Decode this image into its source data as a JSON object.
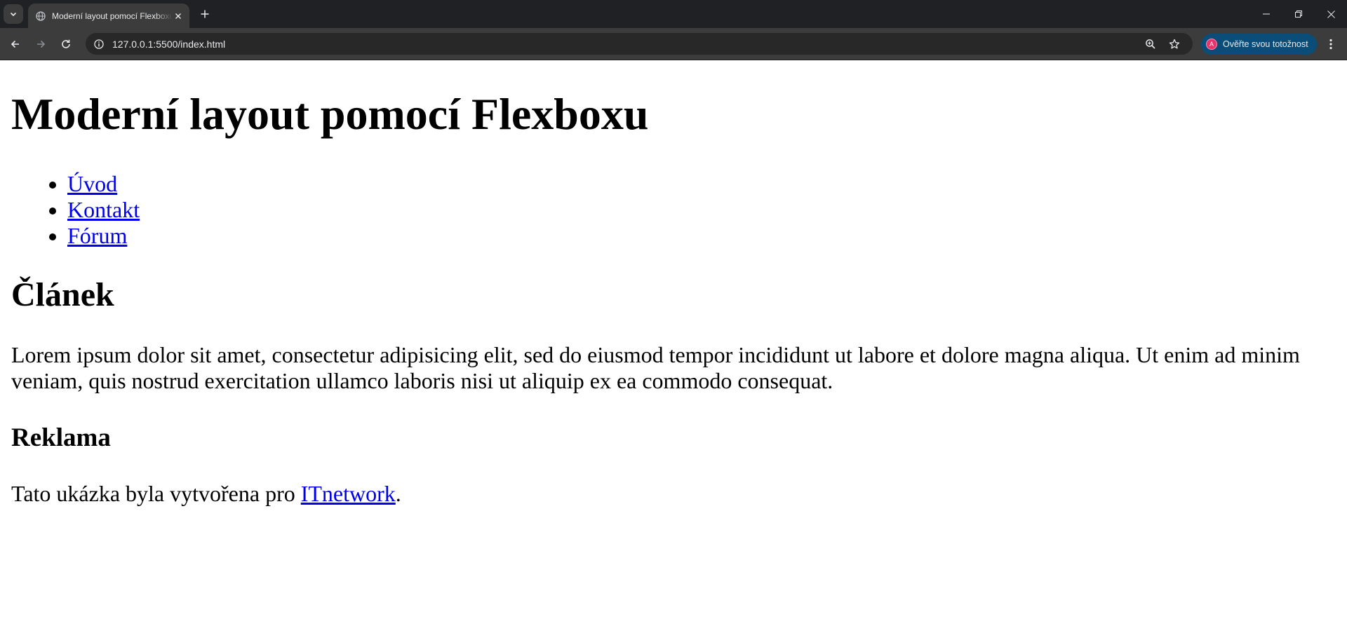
{
  "browser": {
    "tab_title": "Moderní layout pomocí Flexboxu",
    "url": "127.0.0.1:5500/index.html",
    "profile_label": "Ověřte svou totožnost",
    "profile_initial": "A"
  },
  "page": {
    "heading": "Moderní layout pomocí Flexboxu",
    "nav": [
      {
        "label": "Úvod"
      },
      {
        "label": "Kontakt"
      },
      {
        "label": "Fórum"
      }
    ],
    "article_title": "Článek",
    "article_text": "Lorem ipsum dolor sit amet, consectetur adipisicing elit, sed do eiusmod tempor incididunt ut labore et dolore magna aliqua. Ut enim ad minim veniam, quis nostrud exercitation ullamco laboris nisi ut aliquip ex ea commodo consequat.",
    "ad_title": "Reklama",
    "footer_prefix": "Tato ukázka byla vytvořena pro ",
    "footer_link": "ITnetwork",
    "footer_suffix": "."
  },
  "icons": {
    "tab_search": "chevron-down-icon",
    "favicon": "globe-icon",
    "tab_close": "close-icon",
    "new_tab": "plus-icon",
    "minimize": "minimize-icon",
    "restore": "restore-icon",
    "close_window": "close-icon",
    "back": "arrow-left-icon",
    "forward": "arrow-right-icon",
    "reload": "reload-icon",
    "site_info": "info-icon",
    "zoom": "zoom-icon",
    "bookmark": "star-icon",
    "menu": "kebab-menu-icon"
  },
  "colors": {
    "chrome_dark": "#202124",
    "toolbar": "#3c3c3c",
    "profile_chip": "#0a4d78",
    "link": "#0000ee"
  }
}
